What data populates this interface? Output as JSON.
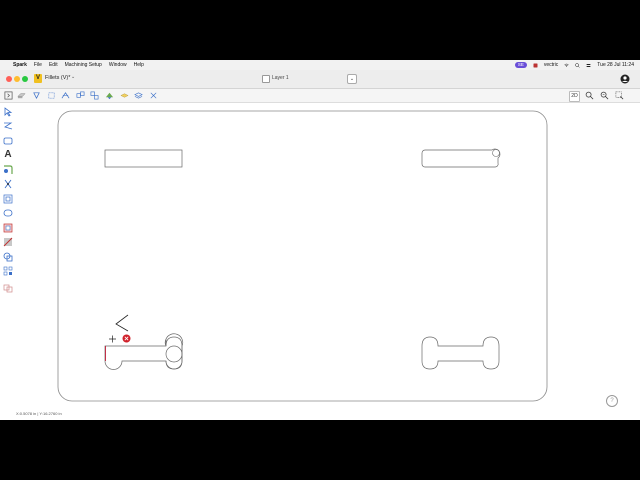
{
  "menubar": {
    "apple": "",
    "items": [
      "Spark",
      "File",
      "Edit",
      "Machining Setup",
      "Window",
      "Help"
    ],
    "status_pill": "SE",
    "vendor": "vectric",
    "clock": "Tue 28 Jul  11:24"
  },
  "titlebar": {
    "doc_icon_letter": "V",
    "doc_title": "Fillets (V)*",
    "doc_chevron": "⌄",
    "layer_name": "Layer 1",
    "layer_dropdown": "⌄"
  },
  "toolbar": {
    "view_2d": "2D"
  },
  "tools": {
    "text_tool": "A"
  },
  "status": {
    "coordinates": "X:0.5078 in | Y:16.2760 in"
  },
  "help": {
    "label": "?"
  },
  "colors": {
    "accent": "#6a4fd8",
    "error": "#d0202a",
    "red_segment": "#c0203a",
    "vector": "#6a6a6a"
  }
}
